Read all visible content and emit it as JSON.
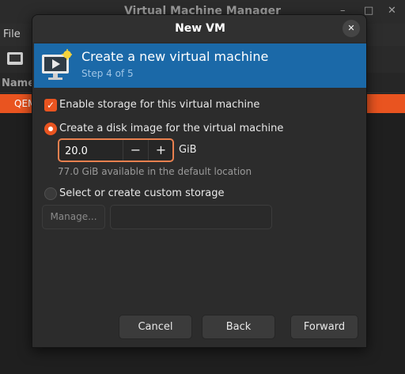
{
  "background_window": {
    "title": "Virtual Machine Manager",
    "menu": {
      "file": "File"
    },
    "column_header": "Name",
    "row_text": "QEMU",
    "controls": {
      "minimize": "–",
      "maximize": "□",
      "close": "✕"
    }
  },
  "dialog": {
    "title": "New VM",
    "close_label": "✕",
    "banner": {
      "title": "Create a new virtual machine",
      "step": "Step 4 of 5"
    },
    "enable_storage": {
      "label": "Enable storage for this virtual machine",
      "checked": true
    },
    "disk_image": {
      "label": "Create a disk image for the virtual machine",
      "selected": true,
      "size_value": "20.0",
      "unit": "GiB",
      "minus_label": "−",
      "plus_label": "+",
      "available": "77.0 GiB available in the default location"
    },
    "custom_storage": {
      "label": "Select or create custom storage",
      "selected": false,
      "manage_label": "Manage...",
      "path_value": ""
    },
    "buttons": {
      "cancel": "Cancel",
      "back": "Back",
      "forward": "Forward"
    }
  },
  "colors": {
    "accent": "#e95420",
    "banner": "#1b69a8",
    "dialog_bg": "#2c2c2c"
  },
  "icons": [
    "monitor-icon",
    "vm-monitor-icon",
    "close-icon",
    "checkbox-check-icon"
  ]
}
